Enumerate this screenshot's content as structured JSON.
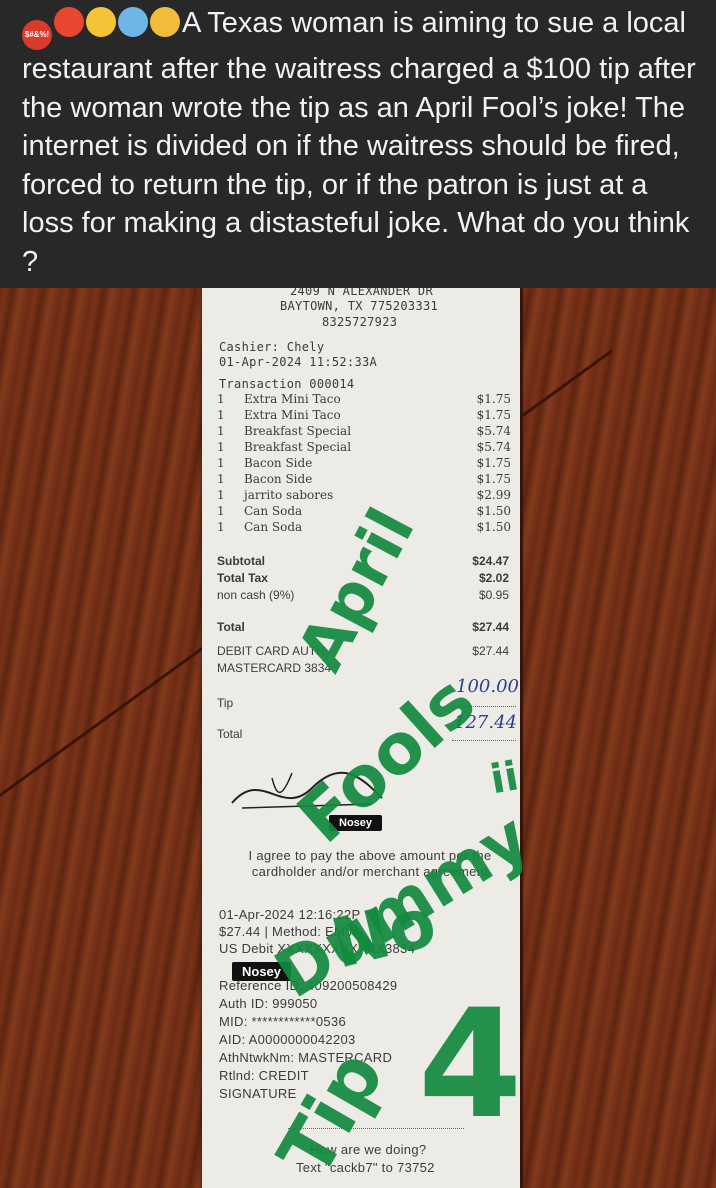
{
  "post": {
    "caption": "A Texas woman is aiming to sue a local restaurant after the waitress charged a $100 tip after the woman wrote the tip as an April Fool’s joke! The internet is divided on if the waitress should be fired, forced to return the tip, or if the patron is just at a loss for making a distasteful joke. What do you think ?",
    "emoji_cursing_text": "$#&%!"
  },
  "receipt": {
    "address": "2409 N ALEXANDER DR",
    "city": "BAYTOWN, TX 775203331",
    "phone": "8325727923",
    "cashier": "Cashier: Chely",
    "datetime": "01-Apr-2024 11:52:33A",
    "transaction": "Transaction 000014",
    "items": [
      {
        "qty": "1",
        "name": "Extra Mini Taco",
        "price": "$1.75"
      },
      {
        "qty": "1",
        "name": "Extra Mini Taco",
        "price": "$1.75"
      },
      {
        "qty": "1",
        "name": "Breakfast Special",
        "price": "$5.74"
      },
      {
        "qty": "1",
        "name": "Breakfast Special",
        "price": "$5.74"
      },
      {
        "qty": "1",
        "name": "Bacon Side",
        "price": "$1.75"
      },
      {
        "qty": "1",
        "name": "Bacon Side",
        "price": "$1.75"
      },
      {
        "qty": "1",
        "name": "jarrito sabores",
        "price": "$2.99"
      },
      {
        "qty": "1",
        "name": "Can Soda",
        "price": "$1.50"
      },
      {
        "qty": "1",
        "name": "Can Soda",
        "price": "$1.50"
      }
    ],
    "subtotal_label": "Subtotal",
    "subtotal_value": "$24.47",
    "tax_label": "Total Tax",
    "tax_value": "$2.02",
    "noncash_label": "non cash (9%)",
    "noncash_value": "$0.95",
    "total_label": "Total",
    "total_value": "$27.44",
    "debit_label": "DEBIT CARD AUTH",
    "debit_value": "$27.44",
    "card_label": "MASTERCARD 3834",
    "tip_label": "Tip",
    "tip_handwritten": "100.00",
    "total2_label": "Total",
    "total_handwritten": "127.44",
    "nosey_badge_1": "Nosey",
    "agreement": "I agree to pay the above amount per the cardholder and/or merchant agreement",
    "txn_date": "01-Apr-2024 12:16:22P",
    "txn_method": "$27.44 | Method: EMV",
    "us_debit": "US Debit XXXXXXXXXXXX3834",
    "nosey_badge_2": "Nosey",
    "reference_id": "Reference ID: 409200508429",
    "auth_id": "Auth ID: 999050",
    "mid": "MID: ************0536",
    "aid": "AID: A0000000042203",
    "athntwk": "AthNtwkNm: MASTERCARD",
    "rtlnd": "Rtlnd: CREDIT",
    "signature": "SIGNATURE",
    "footer_q": "How are we doing?",
    "footer_text": "Text \"cackb7\" to 73752"
  },
  "graffiti": {
    "april": "April",
    "fools": "Fools",
    "dummy": "Dummy",
    "no": "No",
    "tip": "Tip",
    "four": "4",
    "ii": "ii"
  },
  "colors": {
    "caption_bg": "#282828",
    "caption_text": "#f2f2f2",
    "wood": "#6b2a14",
    "receipt": "#ecebe6",
    "marker_green": "#138a3e",
    "pen_blue": "#2a3f8e"
  }
}
